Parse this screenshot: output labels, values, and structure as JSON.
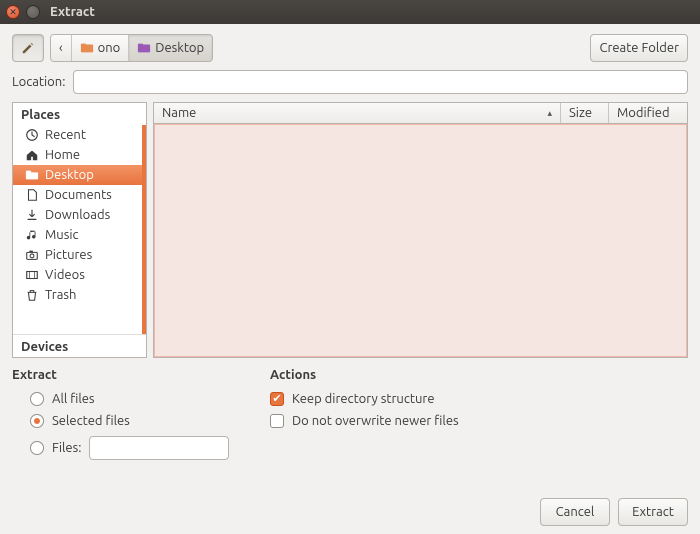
{
  "window": {
    "title": "Extract"
  },
  "toolbar": {
    "breadcrumbs": {
      "chevron": "‹",
      "seg1": "ono",
      "seg2": "Desktop"
    },
    "create_folder": "Create Folder"
  },
  "location": {
    "label": "Location:",
    "value": ""
  },
  "places": {
    "header": "Places",
    "items": [
      {
        "label": "Recent",
        "icon": "clock-icon",
        "selected": false
      },
      {
        "label": "Home",
        "icon": "home-icon",
        "selected": false
      },
      {
        "label": "Desktop",
        "icon": "folder-icon",
        "selected": true
      },
      {
        "label": "Documents",
        "icon": "document-icon",
        "selected": false
      },
      {
        "label": "Downloads",
        "icon": "download-icon",
        "selected": false
      },
      {
        "label": "Music",
        "icon": "music-icon",
        "selected": false
      },
      {
        "label": "Pictures",
        "icon": "camera-icon",
        "selected": false
      },
      {
        "label": "Videos",
        "icon": "video-icon",
        "selected": false
      },
      {
        "label": "Trash",
        "icon": "trash-icon",
        "selected": false
      }
    ],
    "devices_header": "Devices"
  },
  "filelist": {
    "columns": {
      "name": "Name",
      "size": "Size",
      "modified": "Modified"
    },
    "sort_indicator": "▴",
    "rows": []
  },
  "extract": {
    "header": "Extract",
    "options": {
      "all_files": "All files",
      "selected_files": "Selected files",
      "files": "Files:"
    },
    "selected": "selected_files",
    "files_value": ""
  },
  "actions": {
    "header": "Actions",
    "keep_dir": {
      "label": "Keep directory structure",
      "checked": true
    },
    "no_overwrite": {
      "label": "Do not overwrite newer files",
      "checked": false
    }
  },
  "footer": {
    "cancel": "Cancel",
    "extract": "Extract"
  }
}
